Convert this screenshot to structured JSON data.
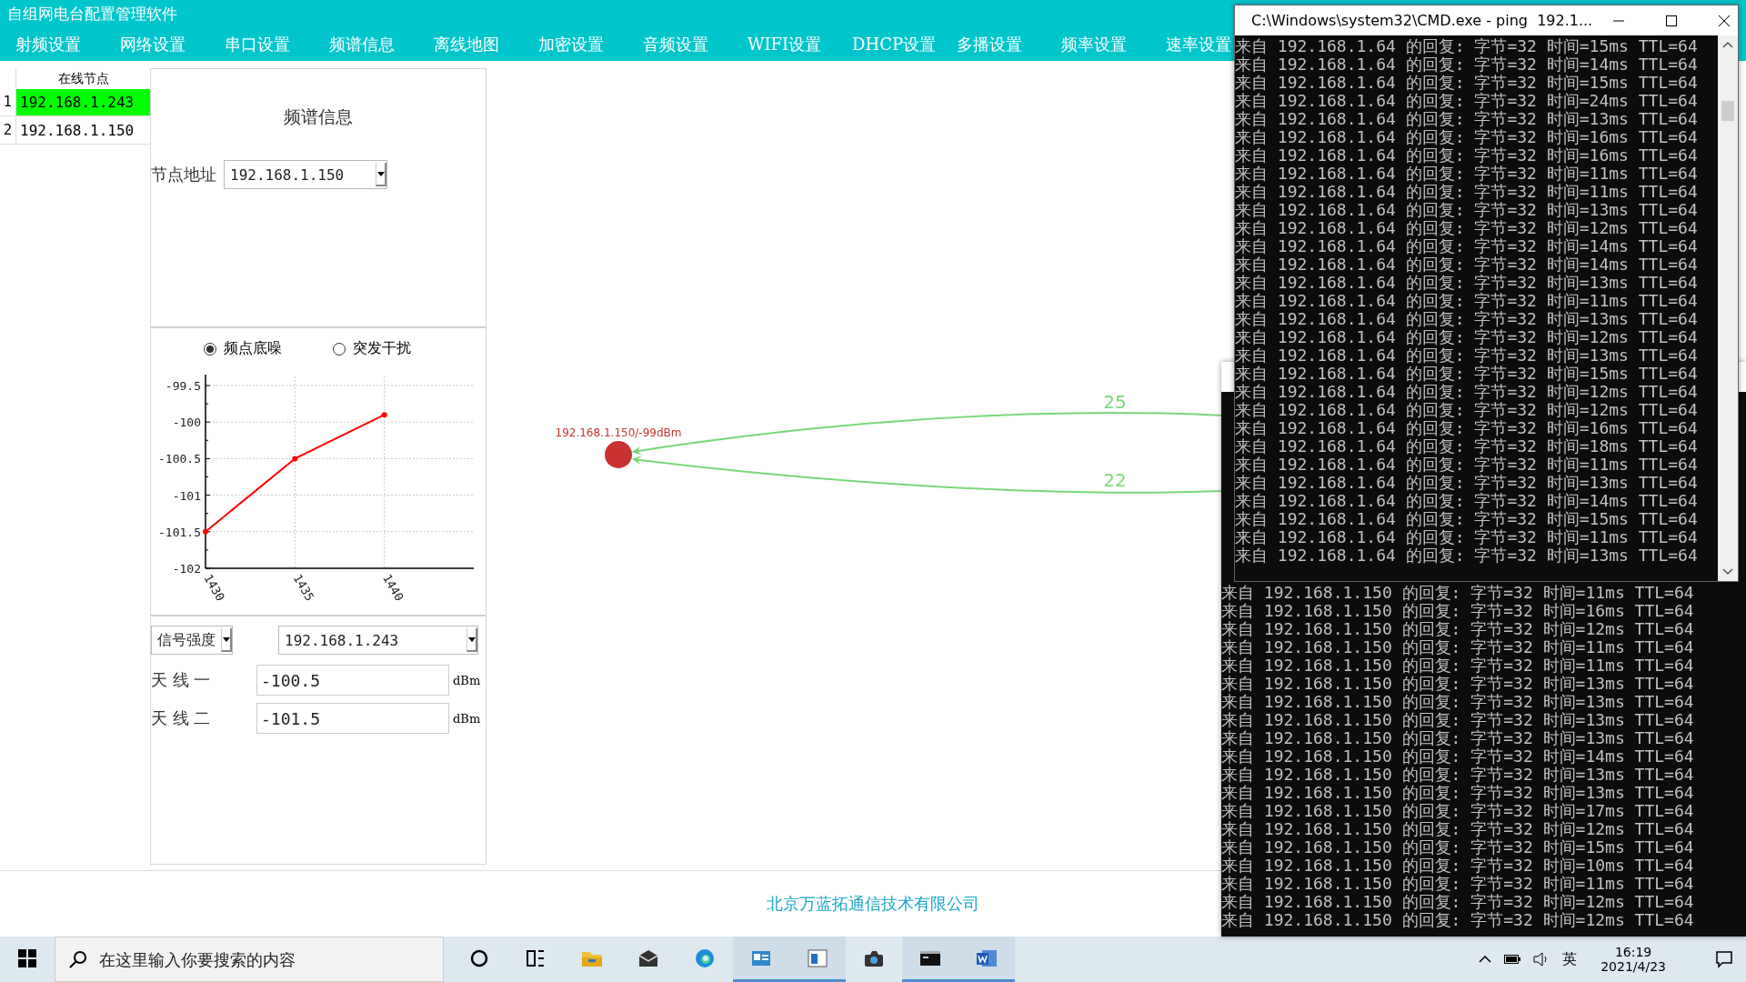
{
  "app": {
    "title": "自组网电台配置管理软件",
    "menu": [
      "射频设置",
      "网络设置",
      "串口设置",
      "频谱信息",
      "离线地图",
      "加密设置",
      "音频设置",
      "WIFI设置",
      "DHCP设置",
      "多播设置",
      "频率设置",
      "速率设置"
    ]
  },
  "node_table": {
    "header": "在线节点",
    "rows": [
      {
        "index": "1",
        "address": "192.168.1.243",
        "selected": true
      },
      {
        "index": "2",
        "address": "192.168.1.150",
        "selected": false
      }
    ]
  },
  "spectrum_panel": {
    "heading": "频谱信息",
    "node_address_label": "节点地址",
    "node_address": "192.168.1.150",
    "modes": [
      {
        "label": "频点底噪",
        "selected": true
      },
      {
        "label": "突发干扰",
        "selected": false
      }
    ],
    "chart_data": {
      "type": "line",
      "grid": true,
      "x": [
        1430,
        1435,
        1440
      ],
      "series": [
        {
          "color": "#ff0000",
          "marker": "circle",
          "values": [
            -101.5,
            -100.5,
            -99.9
          ]
        }
      ],
      "xlim": [
        1430,
        1445
      ],
      "ylim": [
        -102,
        -99.5
      ],
      "xticks": [
        1430,
        1435,
        1440
      ],
      "yticks": [
        {
          "value": -99.5,
          "label": "-99.5"
        },
        {
          "value": -100,
          "label": "-100"
        },
        {
          "value": -100.5,
          "label": "-100.5"
        },
        {
          "value": -101,
          "label": "-101"
        },
        {
          "value": -101.5,
          "label": "-101.5"
        },
        {
          "value": -102,
          "label": "-102"
        }
      ]
    },
    "metric_select": "信号强度",
    "peer_select": "192.168.1.243",
    "antennas": [
      {
        "label": "天 线 一",
        "value": "-100.5",
        "unit": "dBm"
      },
      {
        "label": "天 线 二",
        "value": "-101.5",
        "unit": "dBm"
      }
    ]
  },
  "map": {
    "nodes": [
      {
        "label": "192.168.1.150/-99dBm",
        "color": "#c83232"
      }
    ],
    "links": [
      {
        "label": "25"
      },
      {
        "label": "22"
      }
    ]
  },
  "footer": {
    "company": "北京万蓝拓通信技术有限公司"
  },
  "cmd_front": {
    "title": "C:\\Windows\\system32\\CMD.exe - ping  192.1...",
    "lines": [
      "来自 192.168.1.64 的回复: 字节=32 时间=15ms TTL=64",
      "来自 192.168.1.64 的回复: 字节=32 时间=14ms TTL=64",
      "来自 192.168.1.64 的回复: 字节=32 时间=15ms TTL=64",
      "来自 192.168.1.64 的回复: 字节=32 时间=24ms TTL=64",
      "来自 192.168.1.64 的回复: 字节=32 时间=13ms TTL=64",
      "来自 192.168.1.64 的回复: 字节=32 时间=16ms TTL=64",
      "来自 192.168.1.64 的回复: 字节=32 时间=16ms TTL=64",
      "来自 192.168.1.64 的回复: 字节=32 时间=11ms TTL=64",
      "来自 192.168.1.64 的回复: 字节=32 时间=11ms TTL=64",
      "来自 192.168.1.64 的回复: 字节=32 时间=13ms TTL=64",
      "来自 192.168.1.64 的回复: 字节=32 时间=12ms TTL=64",
      "来自 192.168.1.64 的回复: 字节=32 时间=14ms TTL=64",
      "来自 192.168.1.64 的回复: 字节=32 时间=14ms TTL=64",
      "来自 192.168.1.64 的回复: 字节=32 时间=13ms TTL=64",
      "来自 192.168.1.64 的回复: 字节=32 时间=11ms TTL=64",
      "来自 192.168.1.64 的回复: 字节=32 时间=13ms TTL=64",
      "来自 192.168.1.64 的回复: 字节=32 时间=12ms TTL=64",
      "来自 192.168.1.64 的回复: 字节=32 时间=13ms TTL=64",
      "来自 192.168.1.64 的回复: 字节=32 时间=15ms TTL=64",
      "来自 192.168.1.64 的回复: 字节=32 时间=12ms TTL=64",
      "来自 192.168.1.64 的回复: 字节=32 时间=12ms TTL=64",
      "来自 192.168.1.64 的回复: 字节=32 时间=16ms TTL=64",
      "来自 192.168.1.64 的回复: 字节=32 时间=18ms TTL=64",
      "来自 192.168.1.64 的回复: 字节=32 时间=11ms TTL=64",
      "来自 192.168.1.64 的回复: 字节=32 时间=13ms TTL=64",
      "来自 192.168.1.64 的回复: 字节=32 时间=14ms TTL=64",
      "来自 192.168.1.64 的回复: 字节=32 时间=15ms TTL=64",
      "来自 192.168.1.64 的回复: 字节=32 时间=11ms TTL=64",
      "来自 192.168.1.64 的回复: 字节=32 时间=13ms TTL=64"
    ]
  },
  "cmd_back": {
    "lines": [
      "来自 192.168.1.150 的回复: 字节=32 时间=11ms TTL=64",
      "来自 192.168.1.150 的回复: 字节=32 时间=16ms TTL=64",
      "来自 192.168.1.150 的回复: 字节=32 时间=12ms TTL=64",
      "来自 192.168.1.150 的回复: 字节=32 时间=11ms TTL=64",
      "来自 192.168.1.150 的回复: 字节=32 时间=11ms TTL=64",
      "来自 192.168.1.150 的回复: 字节=32 时间=13ms TTL=64",
      "来自 192.168.1.150 的回复: 字节=32 时间=13ms TTL=64",
      "来自 192.168.1.150 的回复: 字节=32 时间=13ms TTL=64",
      "来自 192.168.1.150 的回复: 字节=32 时间=13ms TTL=64",
      "来自 192.168.1.150 的回复: 字节=32 时间=14ms TTL=64",
      "来自 192.168.1.150 的回复: 字节=32 时间=13ms TTL=64",
      "来自 192.168.1.150 的回复: 字节=32 时间=13ms TTL=64",
      "来自 192.168.1.150 的回复: 字节=32 时间=17ms TTL=64",
      "来自 192.168.1.150 的回复: 字节=32 时间=12ms TTL=64",
      "来自 192.168.1.150 的回复: 字节=32 时间=15ms TTL=64",
      "来自 192.168.1.150 的回复: 字节=32 时间=10ms TTL=64",
      "来自 192.168.1.150 的回复: 字节=32 时间=11ms TTL=64",
      "来自 192.168.1.150 的回复: 字节=32 时间=12ms TTL=64",
      "来自 192.168.1.150 的回复: 字节=32 时间=12ms TTL=64"
    ]
  },
  "taskbar": {
    "search_placeholder": "在这里输入你要搜索的内容",
    "apps": [
      {
        "kind": "cortana",
        "running": false
      },
      {
        "kind": "taskview",
        "running": false
      },
      {
        "kind": "folder",
        "running": false
      },
      {
        "kind": "mail",
        "running": false
      },
      {
        "kind": "browser",
        "running": false
      },
      {
        "kind": "card",
        "running": true
      },
      {
        "kind": "window",
        "running": true
      },
      {
        "kind": "camera",
        "running": false
      },
      {
        "kind": "terminal",
        "running": true
      },
      {
        "kind": "word",
        "running": true
      }
    ],
    "ime": "英",
    "time": "16:19",
    "date": "2021/4/23"
  }
}
